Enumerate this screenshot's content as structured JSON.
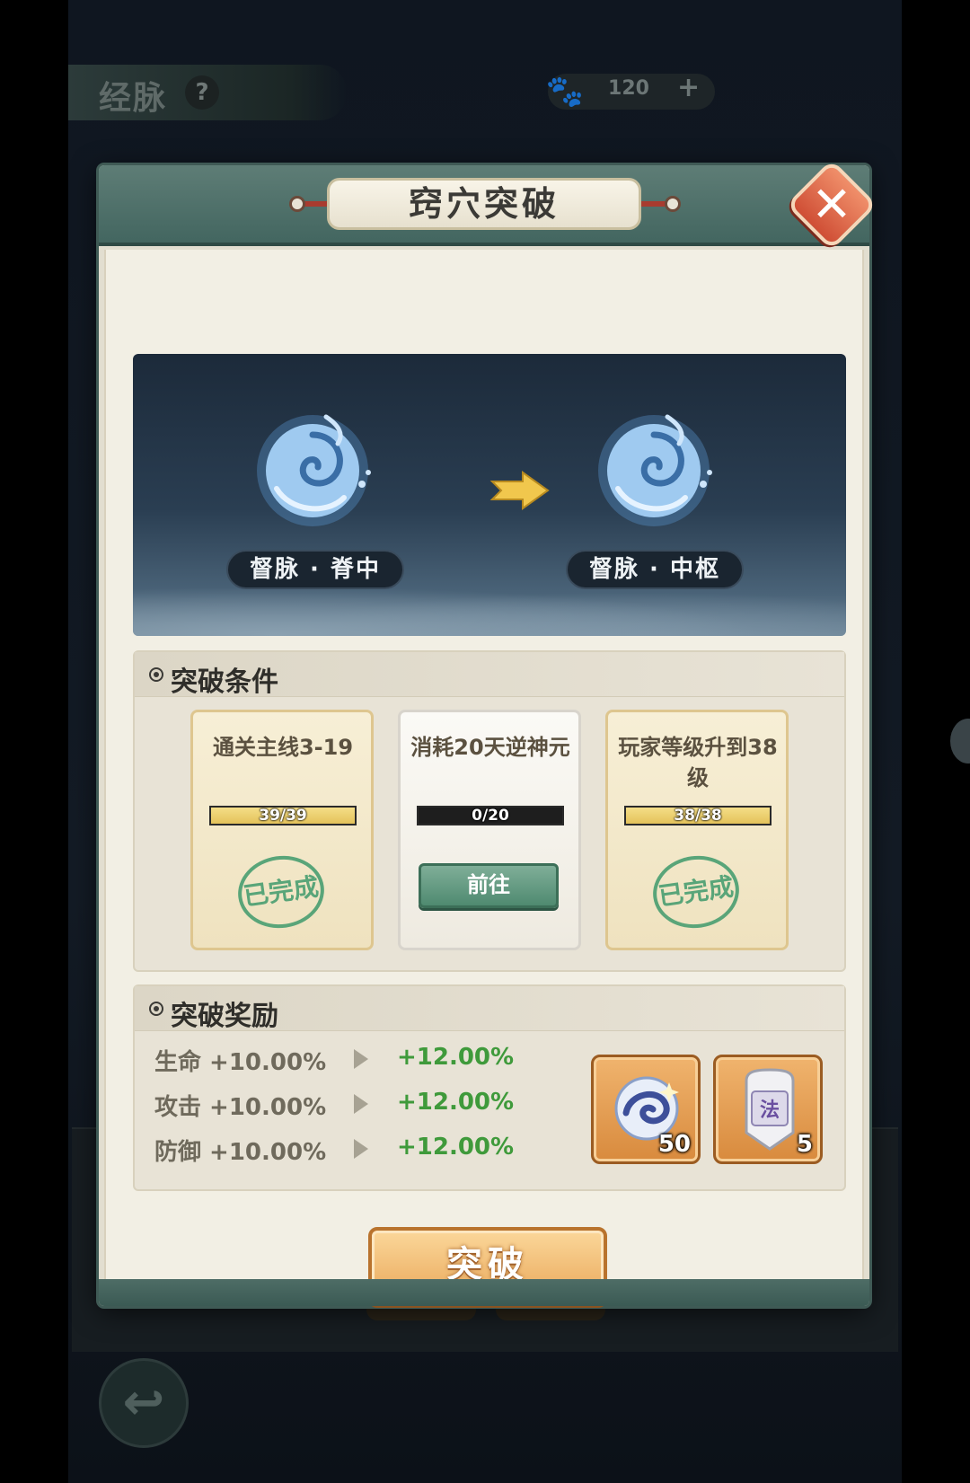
{
  "background": {
    "title": "经脉",
    "help": "?",
    "currency": {
      "icon": "beast-currency-icon",
      "value": "120",
      "plus": "+"
    },
    "back": "↩"
  },
  "dialog": {
    "title": "窍穴突破",
    "close_label": "✕",
    "transition": {
      "from_label": "督脉 · 脊中",
      "to_label": "督脉 · 中枢"
    },
    "conditions": {
      "title": "突破条件",
      "items": [
        {
          "text": "通关主线3-19",
          "progress": "39/39",
          "current": 39,
          "total": 39,
          "status": "已完成"
        },
        {
          "text": "消耗20天逆神元",
          "progress": "0/20",
          "current": 0,
          "total": 20,
          "action": "前往"
        },
        {
          "text": "玩家等级升到38级",
          "progress": "38/38",
          "current": 38,
          "total": 38,
          "status": "已完成"
        }
      ]
    },
    "rewards": {
      "title": "突破奖励",
      "stats": [
        {
          "name": "生命 +10.00%",
          "new": "+12.00%"
        },
        {
          "name": "攻击 +10.00%",
          "new": "+12.00%"
        },
        {
          "name": "防御 +10.00%",
          "new": "+12.00%"
        }
      ],
      "items": [
        {
          "icon": "spirit-orb-icon",
          "count": "50"
        },
        {
          "icon": "law-talisman-icon",
          "glyph": "法",
          "count": "5"
        }
      ]
    },
    "break_button": "突破"
  },
  "colors": {
    "header": "#4f706a",
    "complete_green": "#3f9a6c",
    "stat_increase": "#3f9a3b",
    "button_orange": "#e9a85a"
  }
}
